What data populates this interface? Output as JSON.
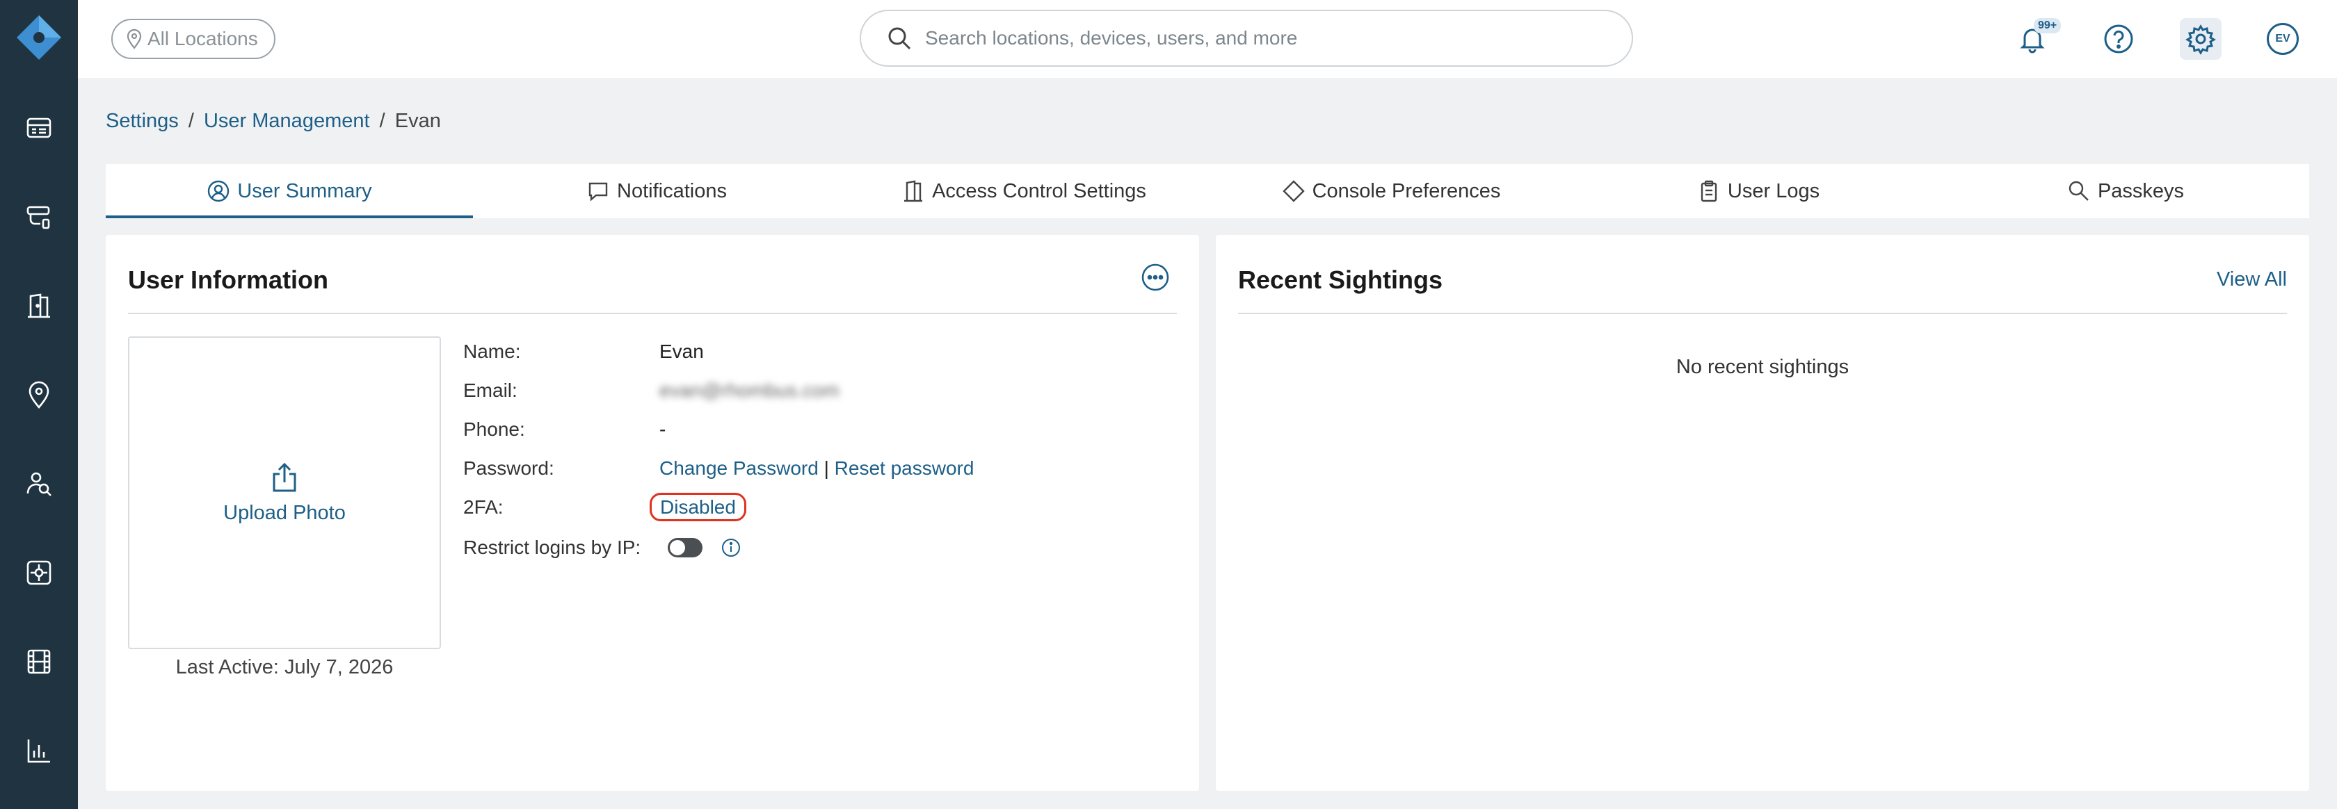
{
  "topbar": {
    "location_filter": "All Locations",
    "search_placeholder": "Search locations, devices, users, and more",
    "notification_badge": "99+",
    "avatar_initials": "EV"
  },
  "sidebar": {
    "items": [
      {
        "icon": "dashboard-icon"
      },
      {
        "icon": "devices-icon"
      },
      {
        "icon": "door-icon"
      },
      {
        "icon": "location-pin-icon"
      },
      {
        "icon": "people-search-icon"
      },
      {
        "icon": "integrations-icon"
      },
      {
        "icon": "video-film-icon"
      },
      {
        "icon": "analytics-chart-icon"
      }
    ]
  },
  "breadcrumb": {
    "settings": "Settings",
    "user_management": "User Management",
    "current": "Evan",
    "separator": "/"
  },
  "tabs": [
    {
      "label": "User Summary",
      "active": true
    },
    {
      "label": "Notifications"
    },
    {
      "label": "Access Control Settings"
    },
    {
      "label": "Console Preferences"
    },
    {
      "label": "User Logs"
    },
    {
      "label": "Passkeys"
    }
  ],
  "user_info": {
    "title": "User Information",
    "upload_photo": "Upload Photo",
    "last_active": "Last Active: July 7, 2026",
    "name_label": "Name:",
    "name_value": "Evan",
    "email_label": "Email:",
    "email_value": "evan@rhombus.com",
    "phone_label": "Phone:",
    "phone_value": "-",
    "password_label": "Password:",
    "change_password": "Change Password",
    "password_sep": "|",
    "reset_password": "Reset password",
    "twofa_label": "2FA:",
    "twofa_value": "Disabled",
    "restrict_label": "Restrict logins by IP:"
  },
  "recent_sightings": {
    "title": "Recent Sightings",
    "view_all": "View All",
    "empty": "No recent sightings"
  },
  "colors": {
    "sidebar_bg": "#1f3340",
    "accent": "#1d5f88",
    "highlight": "#e0321f",
    "page_bg": "#eff1f3"
  }
}
